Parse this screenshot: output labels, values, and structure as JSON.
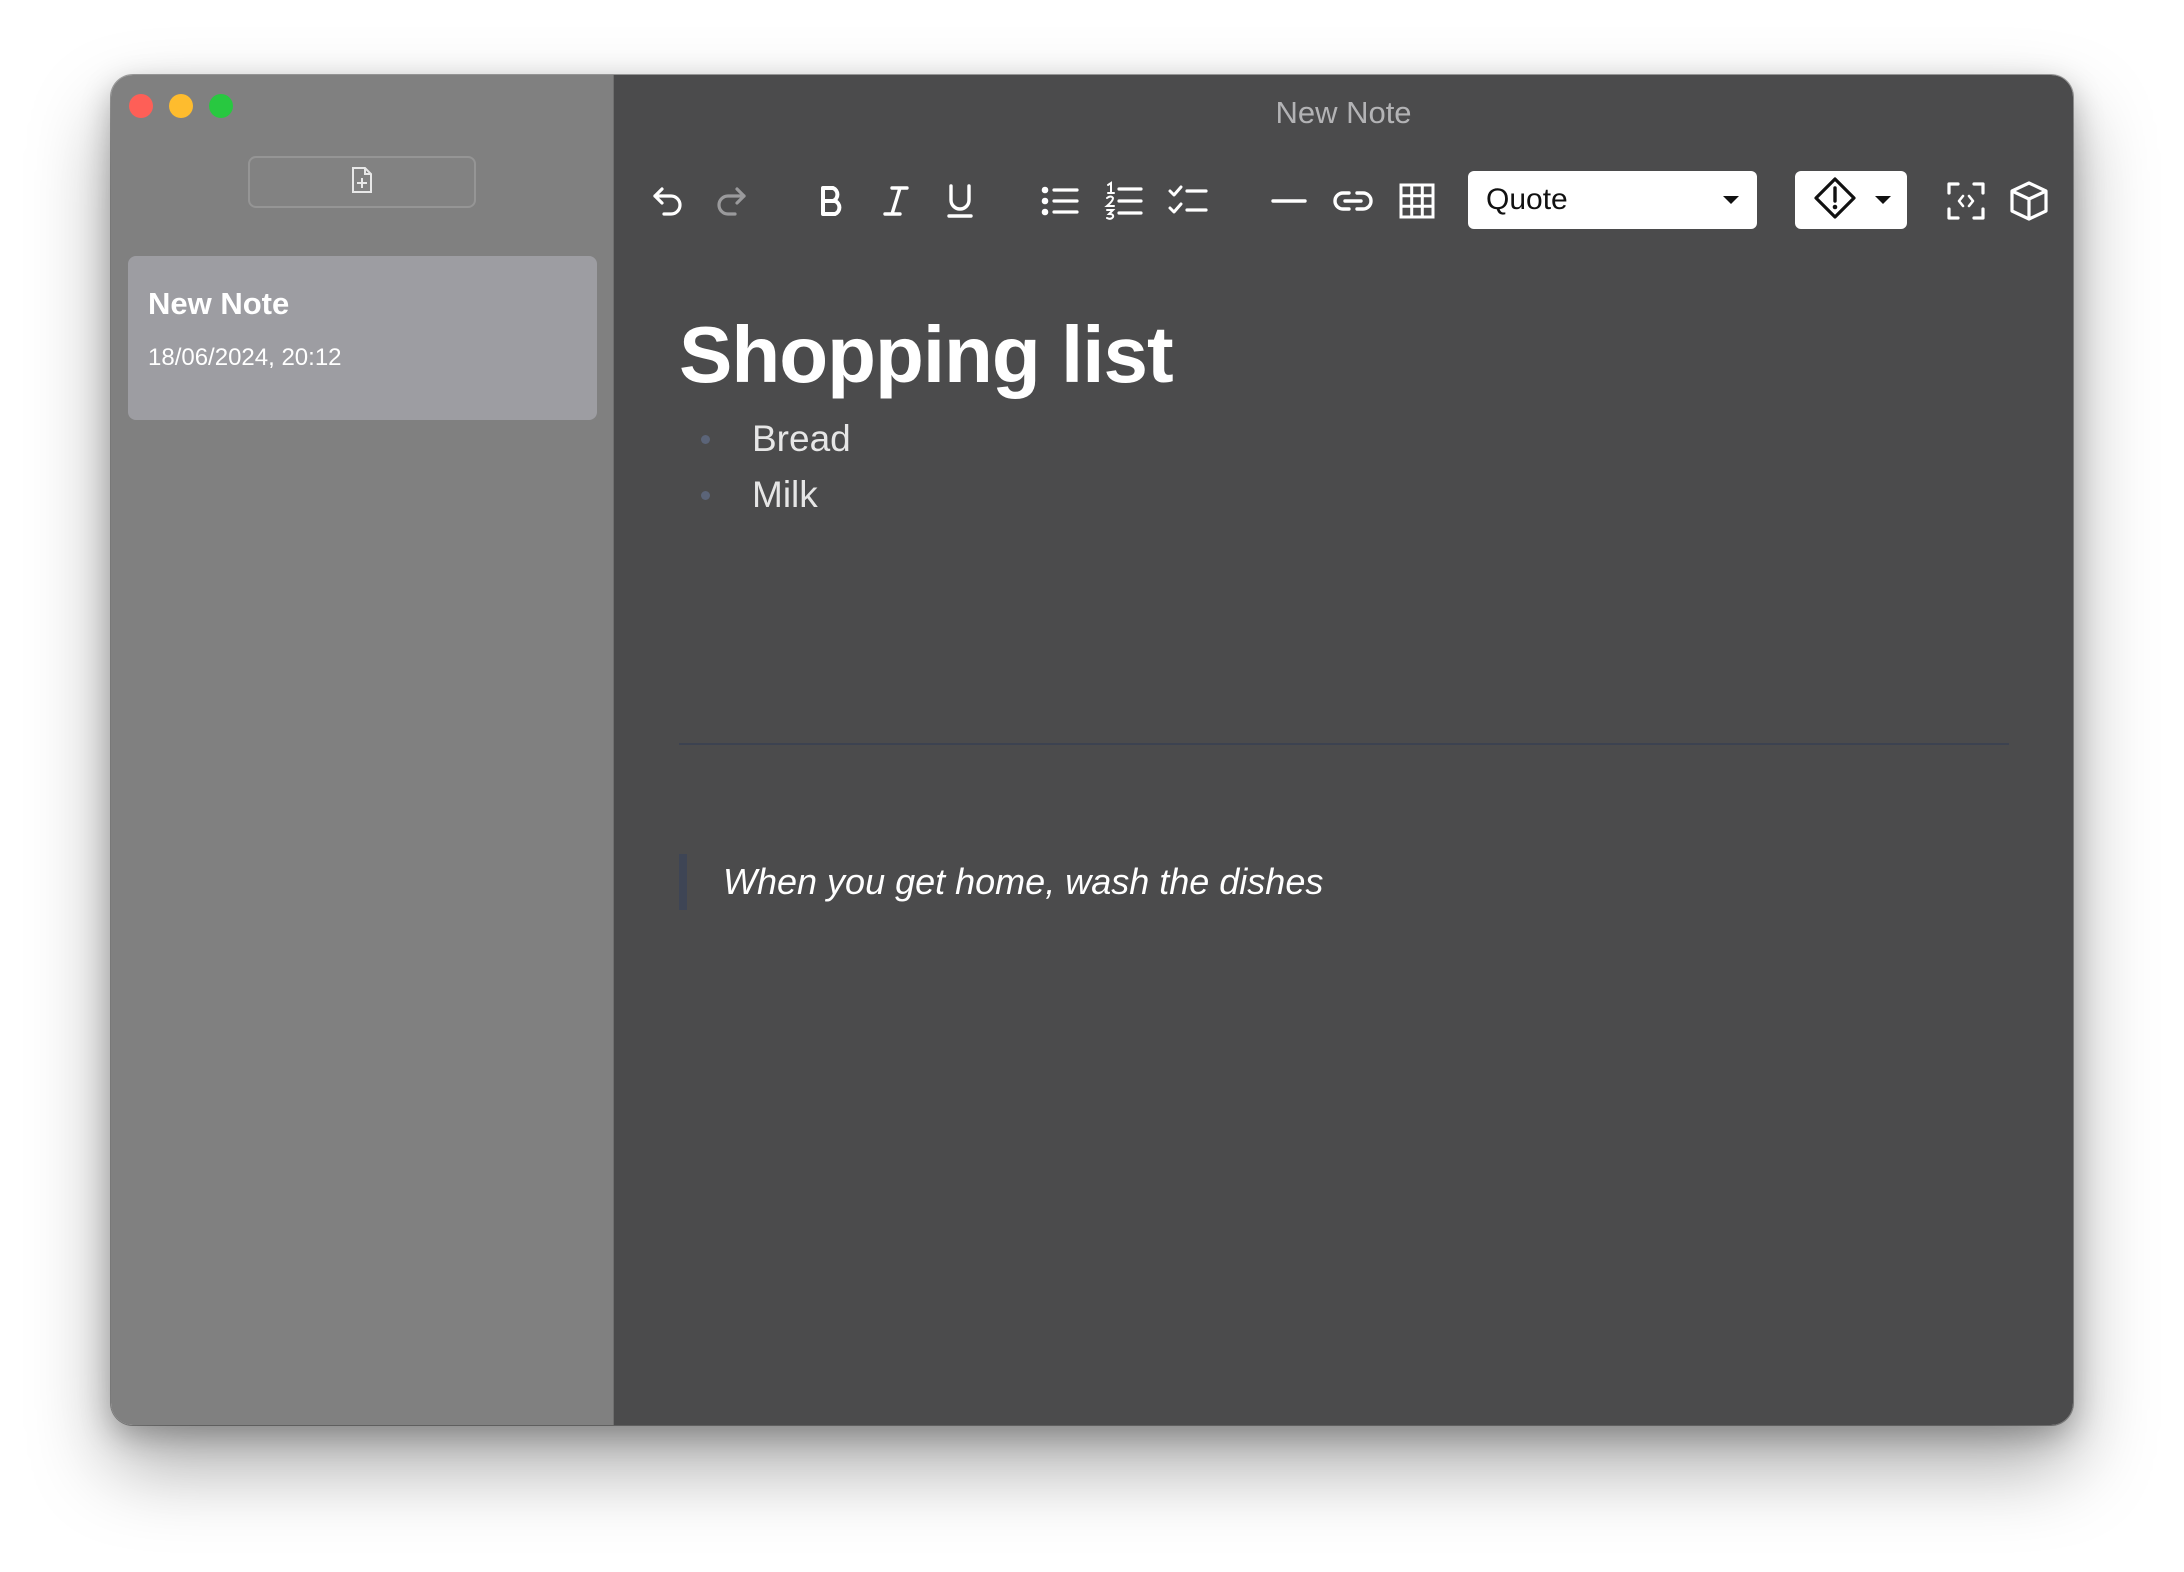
{
  "window": {
    "title": "New Note"
  },
  "sidebar": {
    "new_note_icon": "file-plus-icon",
    "notes": [
      {
        "title": "New Note",
        "date": "18/06/2024, 20:12"
      }
    ]
  },
  "toolbar": {
    "icons": [
      "undo-icon",
      "redo-icon",
      "bold-icon",
      "italic-icon",
      "underline-icon",
      "bullet-list-icon",
      "numbered-list-icon",
      "checklist-icon",
      "horizontal-rule-icon",
      "link-icon",
      "table-icon",
      "alert-icon",
      "fullscreen-icon",
      "cube-icon"
    ],
    "block_type": "Quote"
  },
  "editor": {
    "heading": "Shopping list",
    "list_items": [
      "Bread",
      "Milk"
    ],
    "quote": "When you get home, wash the dishes"
  },
  "colors": {
    "sidebar_bg": "#808080",
    "note_selected_bg": "#9d9da2",
    "editor_bg": "#4b4b4c",
    "traffic_red": "#fe5f57",
    "traffic_yellow": "#febc2e",
    "traffic_green": "#28c840"
  }
}
